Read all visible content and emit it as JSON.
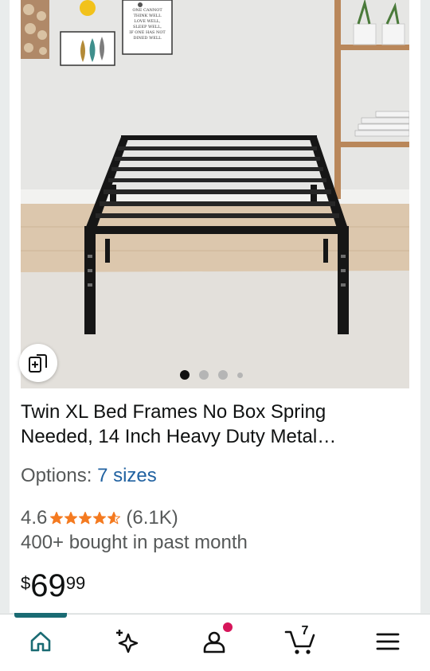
{
  "product": {
    "title_line1": "Twin XL Bed Frames No Box Spring",
    "title_line2": "Needed, 14 Inch Heavy Duty Metal…",
    "options_label": "Options:",
    "options_link": "7 sizes",
    "rating_value": "4.6",
    "rating_stars": 4.6,
    "rating_count": "(6.1K)",
    "bought_text": "400+ bought in past month",
    "price_symbol": "$",
    "price_whole": "69",
    "price_fraction": "99"
  },
  "gallery": {
    "total_images_indicator": 4,
    "active_index": 0
  },
  "wall_sign_lines": [
    "ONE CANNOT",
    "THINK WELL",
    "LOVE WELL,",
    "SLEEP WELL,",
    "IF ONE HAS NOT",
    "DINED WELL"
  ],
  "nav": {
    "cart_count": "7",
    "items": [
      "home-icon",
      "sparkle-icon",
      "account-icon",
      "cart-icon",
      "menu-icon"
    ]
  },
  "colors": {
    "link": "#2162a1",
    "star": "#f47a20",
    "nav_accent": "#1a6b73",
    "notification": "#d6155a"
  }
}
